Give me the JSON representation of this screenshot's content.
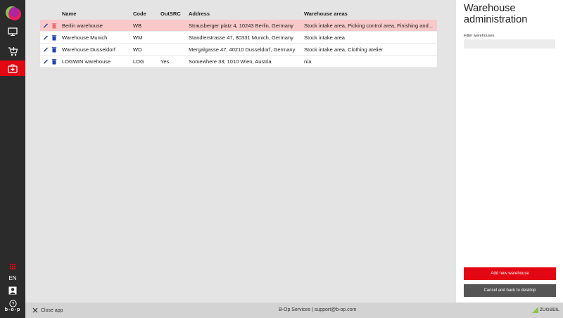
{
  "rail": {
    "language": "EN",
    "brand": "b-o-p"
  },
  "table": {
    "columns": [
      "Name",
      "Code",
      "OutSRC",
      "Address",
      "Warehouse areas"
    ],
    "rows": [
      {
        "name": "Berlin warehouse",
        "code": "WB",
        "outsrc": "",
        "address": "Strausberger platz 4, 10243 Berlin, Germany",
        "areas": "Stock intake area, Picking control area, Finishing and..."
      },
      {
        "name": "Warehouse Munich",
        "code": "WM",
        "outsrc": "",
        "address": "Standlerstrasse 47, 80331 Munich, Germany",
        "areas": "Stock intake area"
      },
      {
        "name": "Warehouse Dusseldorf",
        "code": "WD",
        "outsrc": "",
        "address": "Mergalgasse 47, 40210 Dusseldorf, Germany",
        "areas": "Stock intake area, Clothing atelier"
      },
      {
        "name": "LOGWIN warehouse",
        "code": "LOG",
        "outsrc": "Yes",
        "address": "Somewhere 33, 1010 Wien, Austria",
        "areas": "n/a"
      }
    ]
  },
  "panel": {
    "title": "Warehouse administration",
    "filter_label": "Filter warehouses",
    "filter_value": "",
    "add_label": "Add new warehouse",
    "cancel_label": "Cancel and back to desktop"
  },
  "footer": {
    "close_label": "Close app",
    "center_text": "B-Op Services | support@b-op.com",
    "brand": "ZUGSEIL"
  },
  "colors": {
    "accent": "#e30613",
    "selected_row": "#f9c8c8",
    "rail": "#2b2b2b"
  }
}
